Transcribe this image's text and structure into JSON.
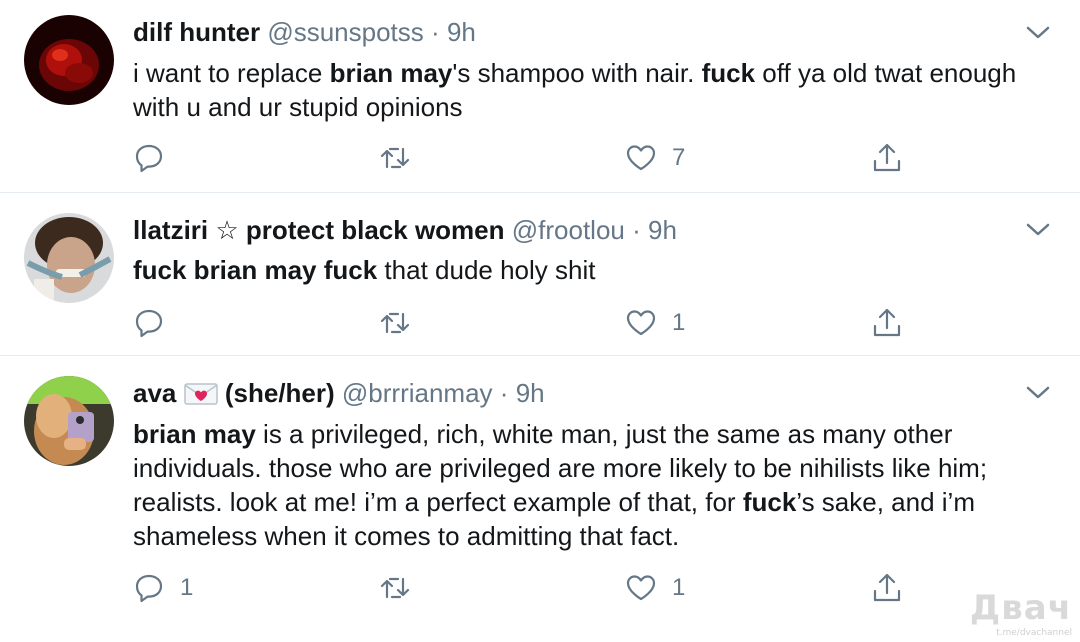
{
  "colors": {
    "text": "#14171a",
    "muted": "#657786",
    "divider": "#e6ecf0",
    "icon": "#657786"
  },
  "tweets": [
    {
      "name": "dilf hunter",
      "handle": "@ssunspotss",
      "sep": "·",
      "time": "9h",
      "body": [
        [
          "i want to replace ",
          false
        ],
        [
          "brian may",
          true
        ],
        [
          "'s shampoo with nair. ",
          false
        ],
        [
          "fuck",
          true
        ],
        [
          " off ya old twat enough with u and ur stupid opinions",
          false
        ]
      ],
      "reply_count": "",
      "retweet_count": "",
      "like_count": "7"
    },
    {
      "name": "llatziri ☆ protect black women",
      "handle": "@frootlou",
      "sep": "·",
      "time": "9h",
      "body": [
        [
          "fuck brian may fuck",
          true
        ],
        [
          " that dude holy shit",
          false
        ]
      ],
      "reply_count": "",
      "retweet_count": "",
      "like_count": "1"
    },
    {
      "name": "ava",
      "name_suffix": "(she/her)",
      "handle": "@brrrianmay",
      "sep": "·",
      "time": "9h",
      "body": [
        [
          "brian may",
          true
        ],
        [
          " is a privileged, rich, white man, just the same as many other individuals. those who are privileged are more likely to be nihilists like him; realists. look at me! i’m a perfect example of that, for ",
          false
        ],
        [
          "fuck",
          true
        ],
        [
          "’s sake, and i’m shameless when it comes to admitting that fact.",
          false
        ]
      ],
      "reply_count": "1",
      "retweet_count": "",
      "like_count": "1"
    }
  ],
  "icons": {
    "reply": "reply-icon",
    "retweet": "retweet-icon",
    "like": "heart-icon",
    "share": "share-icon",
    "more": "chevron-down-icon"
  },
  "watermark": {
    "main": "Двач",
    "sub": "t.me/dvachannel"
  }
}
